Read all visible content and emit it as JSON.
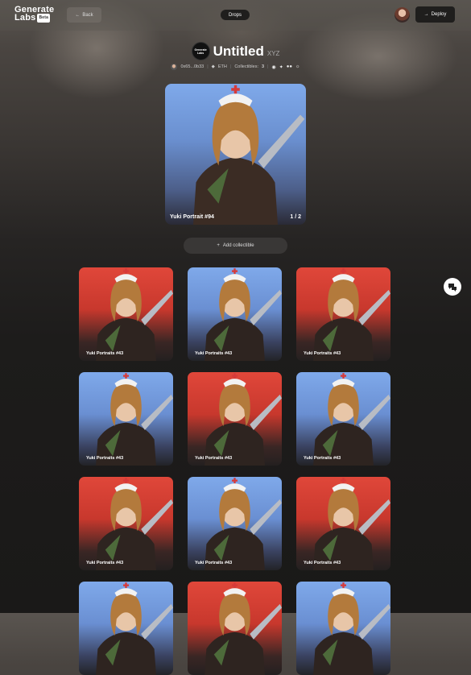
{
  "header": {
    "logo_line1": "Generate",
    "logo_line2": "Labs",
    "logo_badge": "Beta",
    "back_label": "Back",
    "drops_label": "Drops",
    "deploy_label": "Deploy"
  },
  "collection": {
    "logo_text_1": "Generate",
    "logo_text_2": "Labs",
    "title": "Untitled",
    "suffix": "XYZ",
    "owner": "0x65...0b33",
    "chain": "ETH",
    "collectibles_label": "Collectibles:",
    "collectibles_count": "3"
  },
  "hero": {
    "name": "Yuki Portrait #94",
    "counter": "1 / 2"
  },
  "add_collectible_label": "Add collectible",
  "grid": {
    "items": [
      {
        "label": "Yuki Portraits #43",
        "bg": "red"
      },
      {
        "label": "Yuki Portraits #43",
        "bg": "blue"
      },
      {
        "label": "Yuki Portraits #43",
        "bg": "red"
      },
      {
        "label": "Yuki Portraits #43",
        "bg": "blue"
      },
      {
        "label": "Yuki Portraits #43",
        "bg": "red"
      },
      {
        "label": "Yuki Portraits #43",
        "bg": "blue"
      },
      {
        "label": "Yuki Portraits #43",
        "bg": "red"
      },
      {
        "label": "Yuki Portraits #43",
        "bg": "blue"
      },
      {
        "label": "Yuki Portraits #43",
        "bg": "red"
      },
      {
        "label": "",
        "bg": "blue"
      },
      {
        "label": "",
        "bg": "red"
      },
      {
        "label": "",
        "bg": "blue"
      }
    ]
  },
  "colors": {
    "red_bg": "#e0473a",
    "blue_bg": "#7fa9ea",
    "dark": "#1f1e1d"
  },
  "icons": {
    "back": "arrow-left-icon",
    "deploy": "arrow-right-icon",
    "add": "plus-icon",
    "chain": "ethereum-icon",
    "socials": [
      "website-icon",
      "twitter-icon",
      "medium-icon",
      "discord-icon"
    ],
    "chat": "chat-icon"
  }
}
